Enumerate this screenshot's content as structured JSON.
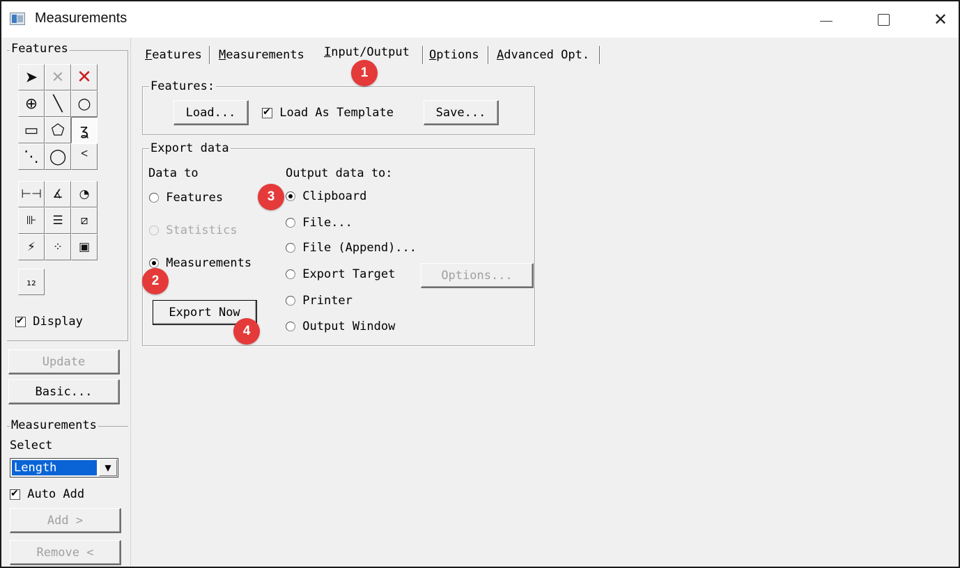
{
  "window": {
    "title": "Measurements",
    "controls": {
      "minimize": "—",
      "maximize": "□",
      "close": "✕"
    }
  },
  "left_panel": {
    "features_group": "Features",
    "tools": [
      {
        "name": "select-arrow-icon",
        "glyph": "➤"
      },
      {
        "name": "delete-gray-icon",
        "glyph": "✕"
      },
      {
        "name": "delete-red-icon",
        "glyph": "✕"
      },
      {
        "name": "crosshair-point-icon",
        "glyph": "⊕"
      },
      {
        "name": "line-tool-icon",
        "glyph": "╲"
      },
      {
        "name": "circle-tool-icon",
        "glyph": "○"
      },
      {
        "name": "rectangle-tool-icon",
        "glyph": "▭"
      },
      {
        "name": "polygon-tool-icon",
        "glyph": "⬠"
      },
      {
        "name": "freehand-tool-icon",
        "glyph": "ʓ"
      },
      {
        "name": "dashed-line-icon",
        "glyph": "⋱"
      },
      {
        "name": "ellipse-tool-icon",
        "glyph": "◯"
      },
      {
        "name": "arc-tool-icon",
        "glyph": "ᑉ"
      },
      {
        "name": "distance-measure-icon",
        "glyph": "⊢⊣"
      },
      {
        "name": "angle-measure-icon",
        "glyph": "∡"
      },
      {
        "name": "gauge-measure-icon",
        "glyph": "◔"
      },
      {
        "name": "profile-measure-icon",
        "glyph": "⊪"
      },
      {
        "name": "stack-measure-icon",
        "glyph": "☰"
      },
      {
        "name": "caliper-measure-icon",
        "glyph": "⧄"
      },
      {
        "name": "scribble-measure-icon",
        "glyph": "⚡"
      },
      {
        "name": "count-dots-icon",
        "glyph": "⁘"
      },
      {
        "name": "region-box-icon",
        "glyph": "▣"
      }
    ],
    "numbering_tool": {
      "name": "numbering-tool-icon",
      "glyph": "₁₂"
    },
    "display_label": "Display",
    "update_button": "Update",
    "basic_button": "Basic...",
    "measurements_group": "Measurements",
    "select_label": "Select",
    "select_value": "Length",
    "auto_add_label": "Auto Add",
    "add_button": "Add >",
    "remove_button": "Remove <"
  },
  "tabs": [
    {
      "label": "Features",
      "key": "F",
      "rest": "eatures"
    },
    {
      "label": "Measurements",
      "key": "M",
      "rest": "easurements"
    },
    {
      "label": "Input/Output",
      "key": "I",
      "rest": "nput/Output"
    },
    {
      "label": "Options",
      "key": "O",
      "rest": "ptions"
    },
    {
      "label": "Advanced Opt.",
      "key": "A",
      "rest": "dvanced Opt."
    }
  ],
  "features_section": {
    "legend": "Features:",
    "load_button": "Load...",
    "load_as_template": "Load As Template",
    "save_button": "Save..."
  },
  "export_section": {
    "legend": "Export data",
    "data_to_label": "Data to",
    "data_to_options": [
      "Features",
      "Statistics",
      "Measurements"
    ],
    "export_now_button": "Export Now",
    "output_label": "Output data to:",
    "output_options": [
      "Clipboard",
      "File...",
      "File (Append)...",
      "Export Target",
      "Printer",
      "Output Window"
    ],
    "options_button": "Options..."
  },
  "badges": [
    "1",
    "2",
    "3",
    "4"
  ],
  "colors": {
    "badge": "#e43a3a",
    "selection": "#0a64d6",
    "delete_red": "#cc1e1e"
  }
}
